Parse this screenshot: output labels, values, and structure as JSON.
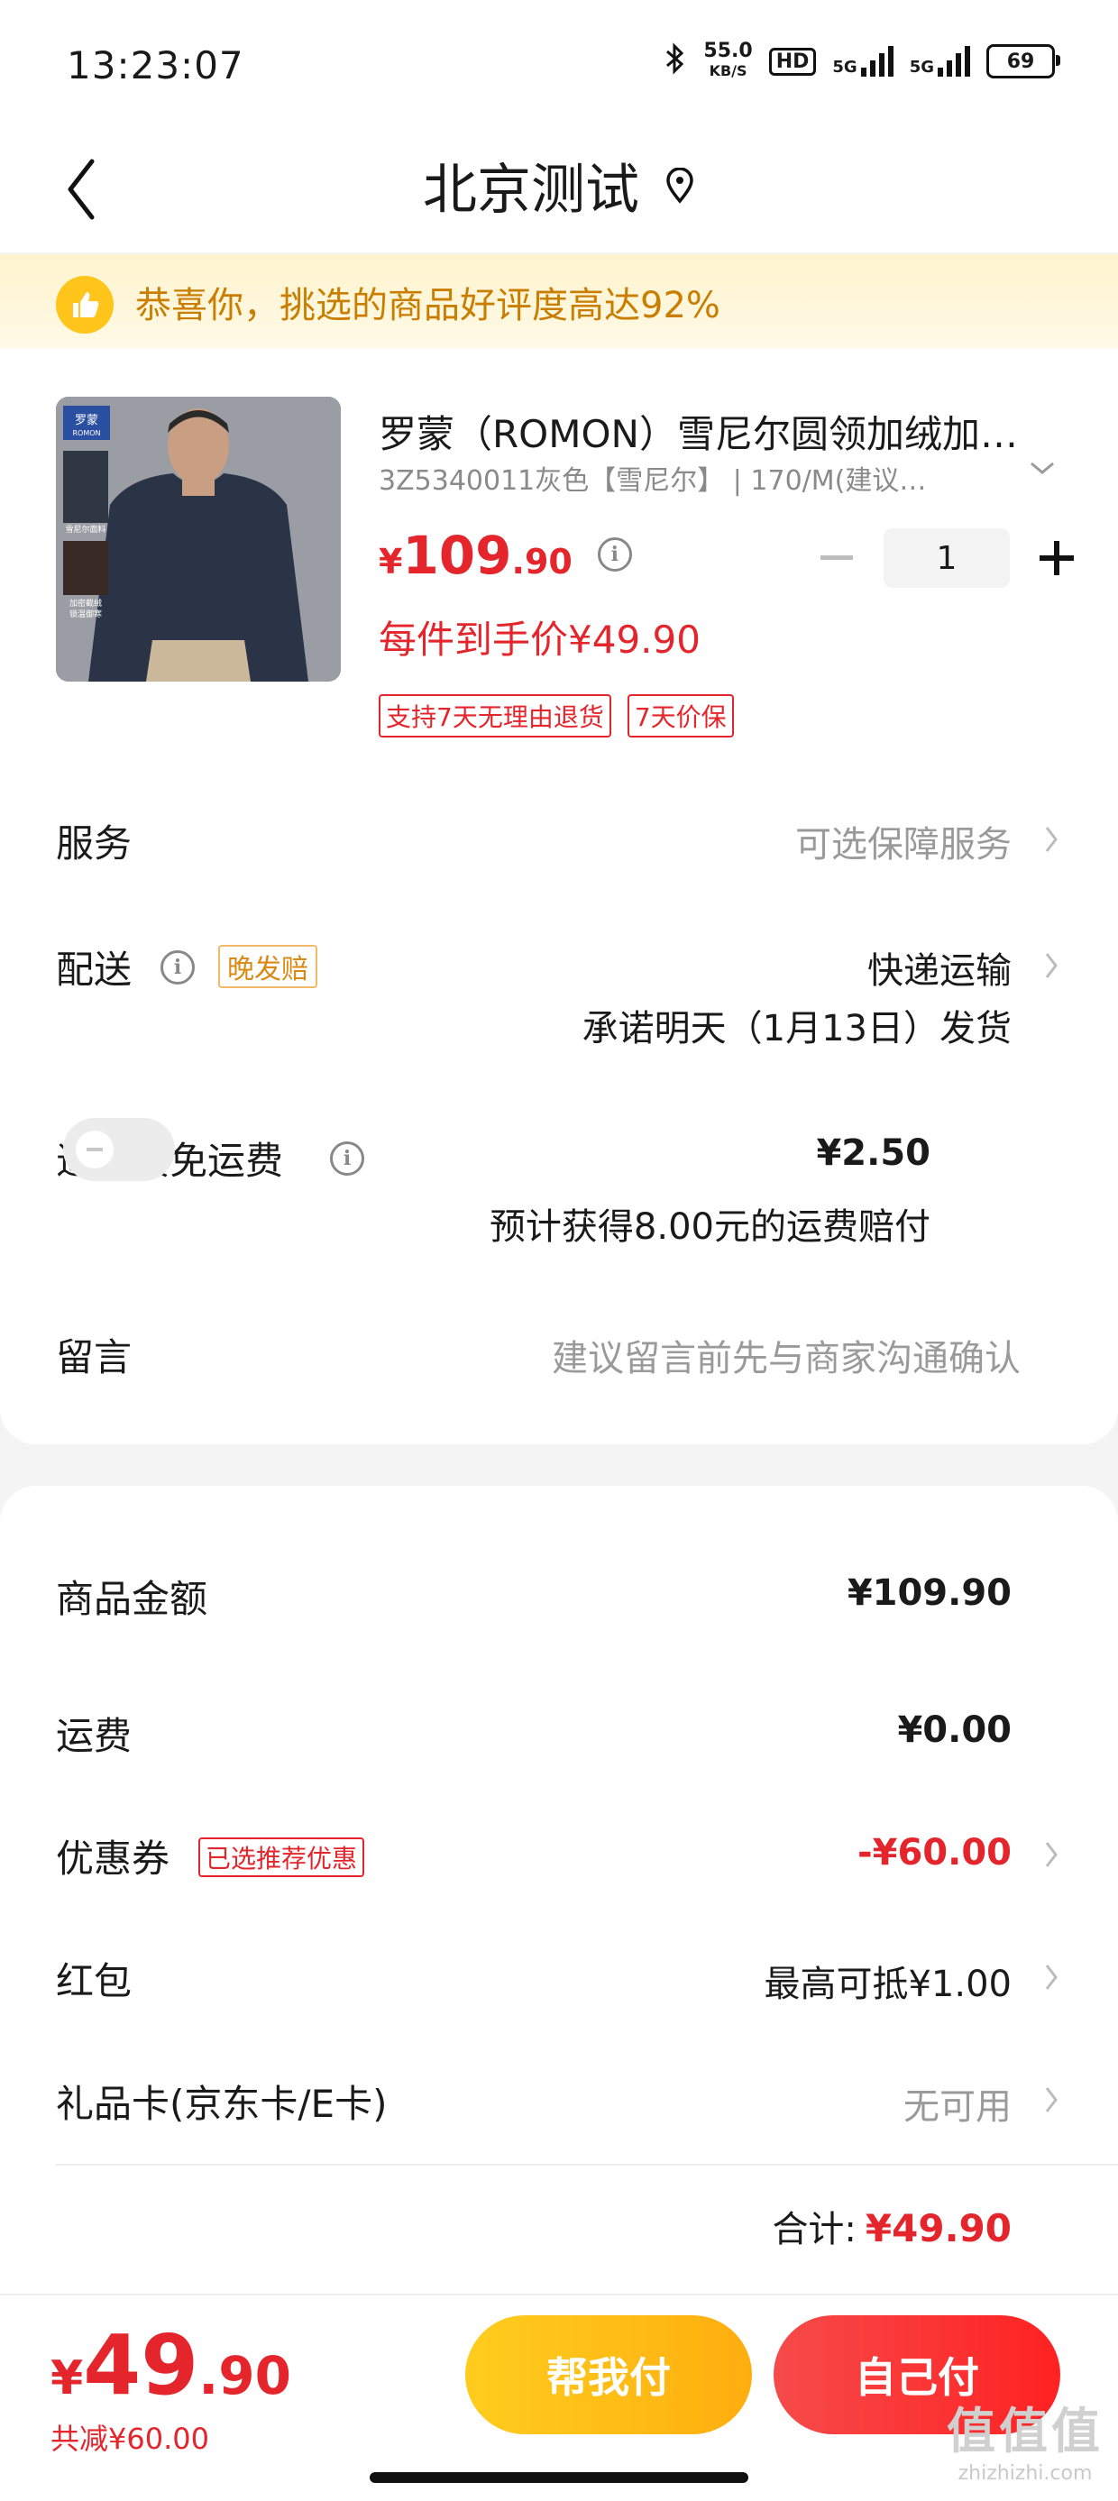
{
  "status_bar": {
    "time": "13:23:07",
    "speed_value": "55.0",
    "speed_unit": "KB/S",
    "hd": "HD",
    "sim1": "5G",
    "sim2": "5G",
    "battery": "69"
  },
  "header": {
    "title": "北京测试",
    "back_icon": "chevron-left-icon",
    "location_icon": "location-pin-icon"
  },
  "banner": {
    "text": "恭喜你，挑选的商品好评度高达92%",
    "icon": "thumbs-up-icon"
  },
  "product": {
    "image_brand_label": "罗蒙",
    "image_brand_sub": "ROMON",
    "image_labels": [
      "雪尼尔面料",
      "加密截绒 锁温御寒"
    ],
    "name": "罗蒙（ROMON）雪尼尔圆领加绒加…",
    "sku": "3Z5340011灰色【雪尼尔】 | 170/M(建议…",
    "price_currency": "¥",
    "price_int": "109",
    "price_dec": ".90",
    "quantity": "1",
    "net_price": "每件到手价¥49.90",
    "tags": [
      "支持7天无理由退货",
      "7天价保"
    ]
  },
  "service": {
    "label": "服务",
    "value": "可选保障服务"
  },
  "delivery": {
    "label": "配送",
    "tag": "晚发赔",
    "method": "快递运输",
    "promise": "承诺明天（1月13日）发货"
  },
  "return_shipping": {
    "label": "退换货免运费",
    "price": "¥2.50",
    "enabled": false,
    "note": "预计获得8.00元的运费赔付"
  },
  "message": {
    "label": "留言",
    "placeholder": "建议留言前先与商家沟通确认"
  },
  "summary": {
    "goods_label": "商品金额",
    "goods_value": "¥109.90",
    "shipping_label": "运费",
    "shipping_value": "¥0.00",
    "coupon_label": "优惠券",
    "coupon_tag": "已选推荐优惠",
    "coupon_value": "-¥60.00",
    "redpacket_label": "红包",
    "redpacket_value": "最高可抵¥1.00",
    "giftcard_label": "礼品卡(京东卡/E卡)",
    "giftcard_value": "无可用",
    "total_label": "合计:",
    "total_value": "¥49.90"
  },
  "bottom_bar": {
    "total_currency": "¥",
    "total_int": "49",
    "total_dec": ".90",
    "saved": "共减¥60.00",
    "help_pay": "帮我付",
    "self_pay": "自己付"
  },
  "watermark": {
    "big": "值值值",
    "small": "zhizhizhi.com"
  },
  "colors": {
    "accent_red": "#e5252c",
    "yellow_button": "#ffc21a",
    "red_button": "#f63535",
    "banner_text": "#c97e00"
  }
}
